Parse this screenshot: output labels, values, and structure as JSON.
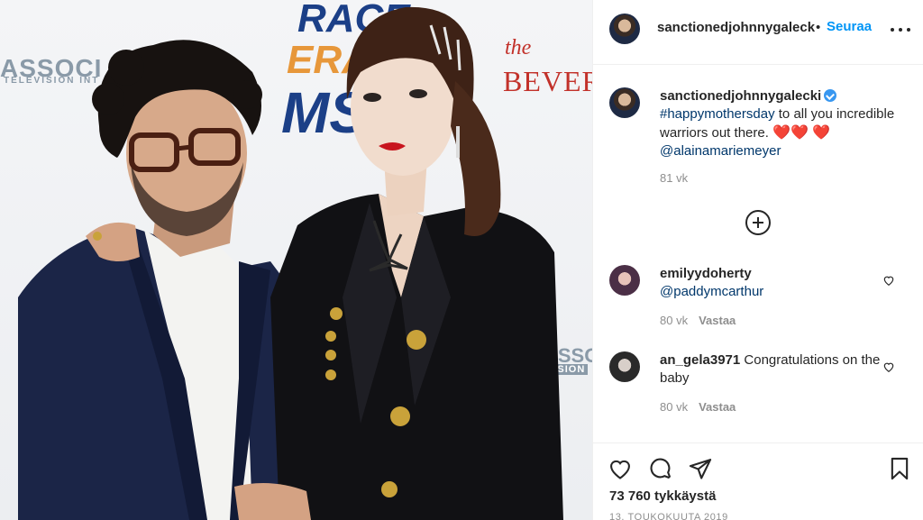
{
  "photo": {
    "backdrop": {
      "assoc_left": "ASSOCI",
      "tv_left": "TELEVISION INT",
      "race_1": "RACE",
      "race_2": "ERA",
      "race_3": "MS",
      "the": "the",
      "beverly": "BEVERL",
      "assoc_right": "ASSOC",
      "vision_right": "VISION"
    }
  },
  "header": {
    "username": "sanctionedjohnnygalecki",
    "separator": "•",
    "follow_label": "Seuraa"
  },
  "caption": {
    "username": "sanctionedjohnnygalecki",
    "hashtag": "#happymothersday",
    "text": " to all you incredible warriors out there. ",
    "hearts_inline": "❤️❤️",
    "heart_wrap": "❤️",
    "mention": "@alainamariemeyer",
    "time": "81 vk"
  },
  "comments": [
    {
      "username": "emilyydoherty",
      "text": "",
      "mention": "@paddymcarthur",
      "time": "80 vk",
      "reply_label": "Vastaa"
    },
    {
      "username": "an_gela3971",
      "text": "Congratulations on the baby",
      "mention": "",
      "time": "80 vk",
      "reply_label": "Vastaa"
    }
  ],
  "actions": {
    "likes": "73 760 tykkäystä",
    "date": "13. TOUKOKUUTA 2019"
  },
  "colors": {
    "accent": "#0095f6",
    "link": "#00376b",
    "muted": "#8e8e8e",
    "text": "#262626"
  },
  "icons": [
    "more-options-icon",
    "verified-badge-icon",
    "load-more-comments-icon",
    "comment-like-icon",
    "like-heart-icon",
    "comment-bubble-icon",
    "share-plane-icon",
    "save-bookmark-icon"
  ]
}
